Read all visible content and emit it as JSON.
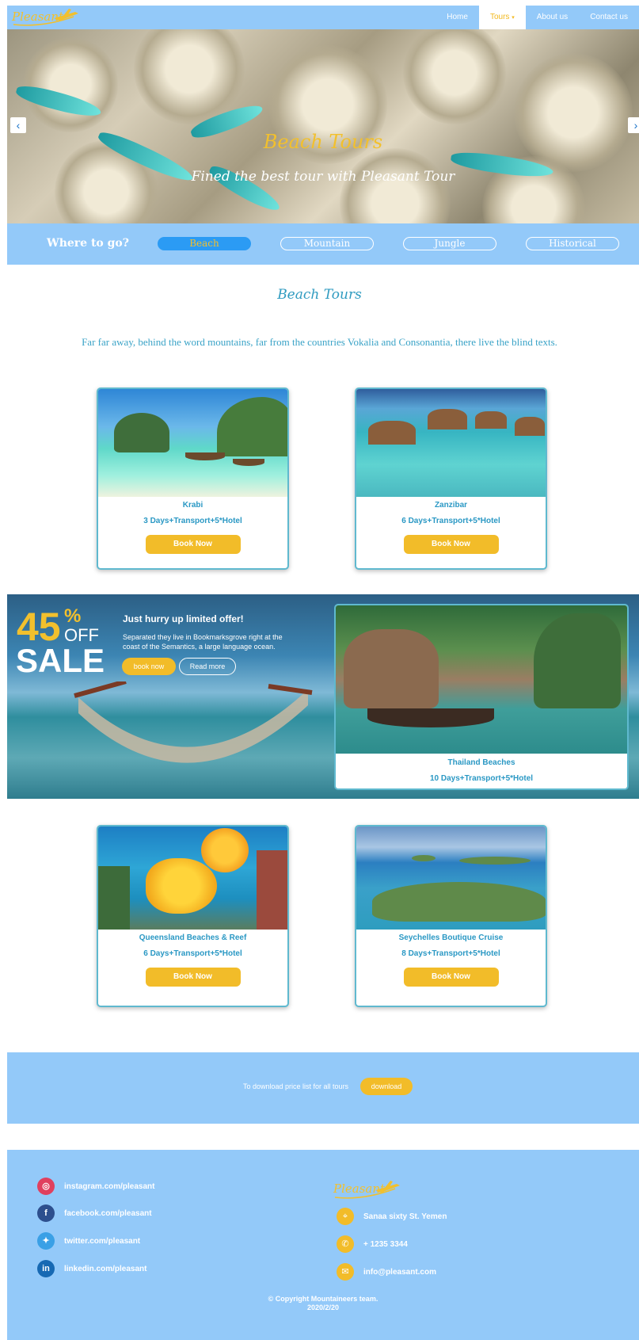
{
  "brand": {
    "logo_text": "Pleasant"
  },
  "nav": {
    "items": [
      {
        "label": "Home"
      },
      {
        "label": "Tours",
        "caret": "▾",
        "active": true
      },
      {
        "label": "About us"
      },
      {
        "label": "Contact us"
      }
    ]
  },
  "hero": {
    "title": "Beach Tours",
    "subtitle": "Fined the best tour with Pleasant Tour",
    "prev_icon": "chevron-left-icon",
    "next_icon": "chevron-right-icon"
  },
  "where": {
    "label": "Where to go?",
    "options": [
      {
        "label": "Beach",
        "active": true
      },
      {
        "label": "Mountain"
      },
      {
        "label": "Jungle"
      },
      {
        "label": "Historical"
      }
    ]
  },
  "section": {
    "title": "Beach Tours",
    "text": "Far far away, behind the word mountains, far from the countries Vokalia and Consonantia, there live the blind texts."
  },
  "tours": [
    {
      "name": "Krabi",
      "details": "3 Days+Transport+5*Hotel",
      "button": "Book Now"
    },
    {
      "name": "Zanzibar",
      "details": "6 Days+Transport+5*Hotel",
      "button": "Book Now"
    },
    {
      "name": "Queensland Beaches & Reef",
      "details": "6 Days+Transport+5*Hotel",
      "button": "Book Now"
    },
    {
      "name": "Seychelles Boutique Cruise",
      "details": "8 Days+Transport+5*Hotel",
      "button": "Book Now"
    }
  ],
  "offer": {
    "percent": "45",
    "percent_sign": "%",
    "off": "OFF",
    "sale": "SALE",
    "headline": "Just hurry up limited offer!",
    "text": "Separated they live in Bookmarksgrove right at the coast of the Semantics, a large language ocean.",
    "book_label": "book now",
    "read_label": "Read more",
    "card": {
      "name": "Thailand Beaches",
      "details": "10 Days+Transport+5*Hotel"
    }
  },
  "download": {
    "text": "To download price list for all tours",
    "button": "download"
  },
  "footer": {
    "social": [
      {
        "label": "instagram.com/pleasant",
        "icon": "instagram-icon",
        "glyph": "◎",
        "color": "#e0405f"
      },
      {
        "label": "facebook.com/pleasant",
        "icon": "facebook-icon",
        "glyph": "f",
        "color": "#2d4f8e"
      },
      {
        "label": "twitter.com/pleasant",
        "icon": "twitter-icon",
        "glyph": "✦",
        "color": "#3aa0e6"
      },
      {
        "label": "linkedin.com/pleasant",
        "icon": "linkedin-icon",
        "glyph": "in",
        "color": "#1769b3"
      }
    ],
    "contact": [
      {
        "label": "Sanaa sixty St. Yemen",
        "icon": "location-icon",
        "glyph": "⌖"
      },
      {
        "label": "+ 1235 3344",
        "icon": "phone-icon",
        "glyph": "✆"
      },
      {
        "label": "info@pleasant.com",
        "icon": "mail-icon",
        "glyph": "✉"
      }
    ],
    "copyright": "© Copyright Mountaineers team.",
    "date": "2020/2/20"
  },
  "colors": {
    "bar": "#93c9f9",
    "accent": "#f2bc29",
    "text_blue": "#2a98c4",
    "active_pill": "#2b9bf4"
  }
}
